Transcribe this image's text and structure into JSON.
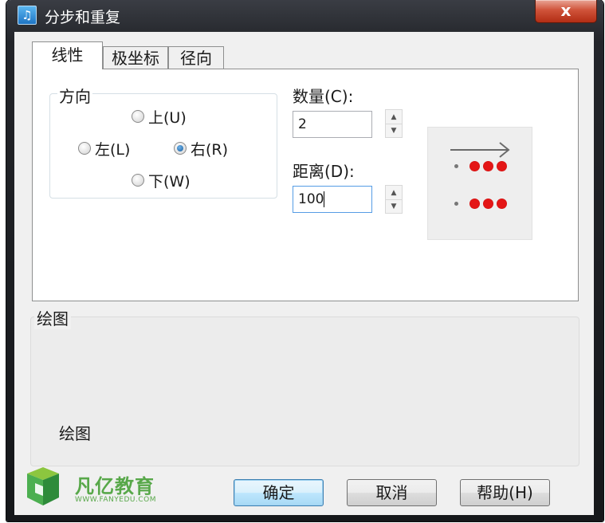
{
  "window": {
    "title": "分步和重复",
    "close_symbol": "x"
  },
  "tabs": [
    {
      "label": "线性",
      "active": true
    },
    {
      "label": "极坐标",
      "active": false
    },
    {
      "label": "径向",
      "active": false
    }
  ],
  "direction": {
    "legend": "方向",
    "options": {
      "up": "上(U)",
      "left": "左(L)",
      "right": "右(R)",
      "down": "下(W)"
    },
    "selected": "右(R)"
  },
  "count": {
    "label": "数量(C):",
    "value": "2"
  },
  "distance": {
    "label": "距离(D):",
    "value": "100"
  },
  "drawing": {
    "legend": "绘图",
    "static_text": "绘图"
  },
  "buttons": {
    "ok": "确定",
    "cancel": "取消",
    "help": "帮助(H)"
  },
  "watermark": {
    "brand": "凡亿教育",
    "url": "WWW.FANYEDU.COM"
  },
  "colors": {
    "preview_dot": "#e41616",
    "default_button": "#bee6fd",
    "watermark": "#58a84a"
  }
}
